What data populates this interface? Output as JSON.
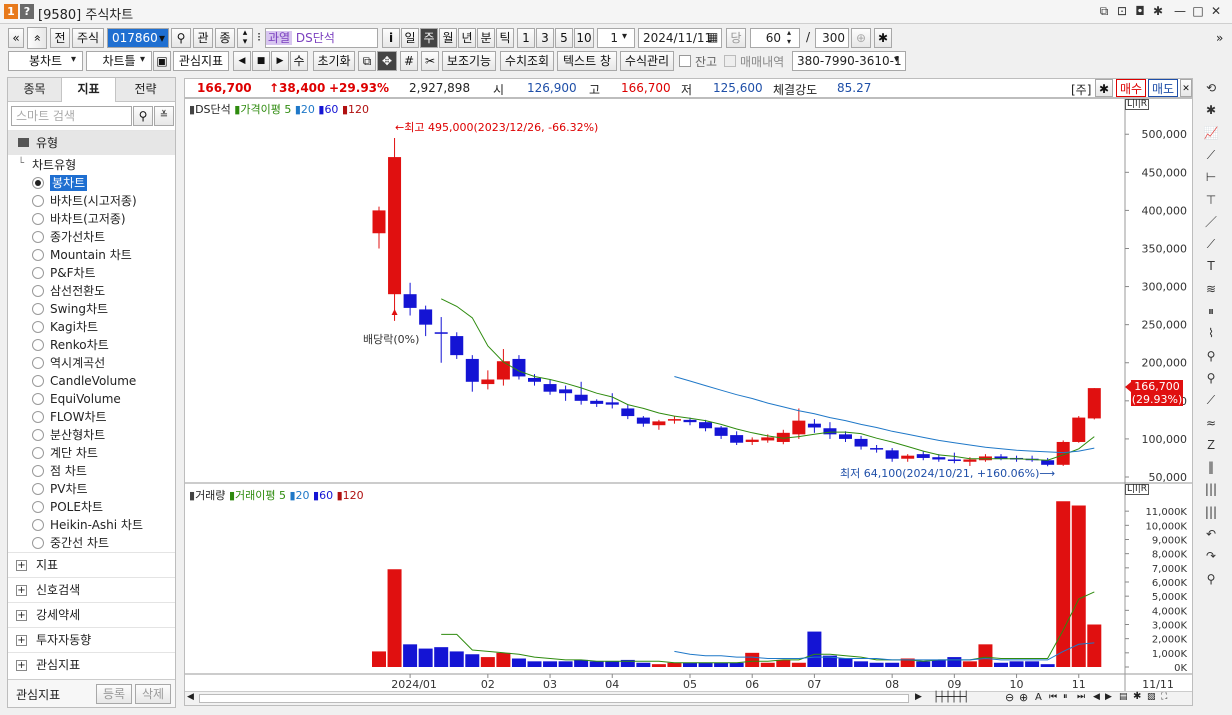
{
  "window": {
    "badge1": "1",
    "badge2": "?",
    "title": "[9580] 주식차트"
  },
  "toolbar1": {
    "items": [
      "«",
      "»",
      "전",
      "주식",
      "017860",
      "관",
      "종"
    ],
    "badge": "과열",
    "stock_name": "DS단석",
    "info": "i",
    "periods": [
      "일",
      "주",
      "월",
      "년",
      "분",
      "틱"
    ],
    "active_period": "주",
    "nums": [
      "1",
      "3",
      "5",
      "10"
    ],
    "sel_one": "1",
    "date": "2024/11/11",
    "dang": "당",
    "count": "60",
    "slash": "/",
    "max": "300"
  },
  "toolbar2": {
    "chart_type": "봉차트",
    "chart_frame": "차트틀",
    "indicator": "관심지표",
    "su": "수",
    "reset": "초기화",
    "aux": "보조기능",
    "num_query": "수치조회",
    "text_window": "텍스트 창",
    "formula": "수식관리",
    "balance": "잔고",
    "trade_history": "매매내역",
    "account": "380-7990-3610-1"
  },
  "price_bar": {
    "price": "166,700",
    "change": "↑38,400",
    "rate": "+29.93%",
    "volume": "2,927,898",
    "open_label": "시",
    "open": "126,900",
    "high_label": "고",
    "high": "166,700",
    "low_label": "저",
    "low": "125,600",
    "strength_label": "체결강도",
    "strength": "85.27",
    "unit": "[주]",
    "buy": "매수",
    "sell": "매도"
  },
  "left_panel": {
    "tabs": [
      "종목",
      "지표",
      "전략"
    ],
    "active_tab": "지표",
    "search_placeholder": "스마트 검색",
    "section": "유형",
    "tree_root": "차트유형",
    "chart_types": [
      "봉차트",
      "바차트(시고저종)",
      "바차트(고저종)",
      "종가선차트",
      "Mountain 차트",
      "P&F차트",
      "삼선전환도",
      "Swing차트",
      "Kagi차트",
      "Renko차트",
      "역시계곡선",
      "CandleVolume",
      "EquiVolume",
      "FLOW차트",
      "분산형차트",
      "계단 차트",
      "점 차트",
      "PV차트",
      "POLE차트",
      "Heikin-Ashi 차트",
      "중간선 차트"
    ],
    "selected_type": "봉차트",
    "groups": [
      "지표",
      "신호검색",
      "강세약세",
      "투자자동향",
      "관심지표"
    ],
    "footer_label": "관심지표",
    "register": "등록",
    "delete": "삭제"
  },
  "price_chart": {
    "legend": {
      "name": "DS단석",
      "ma_label": "가격이평",
      "periods": [
        "5",
        "20",
        "60",
        "120"
      ]
    },
    "y_ticks": [
      "500,000",
      "450,000",
      "400,000",
      "350,000",
      "300,000",
      "250,000",
      "200,000",
      "150,000",
      "100,000",
      "50,000"
    ],
    "high_annotation": "←최고 495,000(2023/12/26, -66.32%)",
    "low_annotation": "최저 64,100(2024/10/21, +160.06%)⟶",
    "dividend": "배당락(0%)",
    "last_price": "166,700",
    "last_rate": "(29.93%)",
    "corner": "L|I|R"
  },
  "volume_chart": {
    "legend": {
      "name": "거래량",
      "ma_label": "거래이평",
      "periods": [
        "5",
        "20",
        "60",
        "120"
      ]
    },
    "y_ticks": [
      "11,000K",
      "10,000K",
      "9,000K",
      "8,000K",
      "7,000K",
      "6,000K",
      "5,000K",
      "4,000K",
      "3,000K",
      "2,000K",
      "1,000K",
      "0K"
    ],
    "corner": "L|I|R"
  },
  "x_axis": [
    "2024/01",
    "02",
    "03",
    "04",
    "05",
    "06",
    "07",
    "08",
    "09",
    "10",
    "11"
  ],
  "x_end": "11/11",
  "colors": {
    "up": "#e01010",
    "down": "#1414d4",
    "ma5": "#2e8b0e",
    "ma20": "#1f78c8",
    "accent": "#1f6fd1"
  },
  "chart_data": {
    "type": "candlestick",
    "title": "DS단석",
    "period": "weekly",
    "candles": [
      {
        "o": 370000,
        "h": 405000,
        "l": 350000,
        "c": 400000
      },
      {
        "o": 290000,
        "h": 495000,
        "l": 255000,
        "c": 470000
      },
      {
        "o": 290000,
        "h": 305000,
        "l": 262000,
        "c": 272000
      },
      {
        "o": 270000,
        "h": 275000,
        "l": 235000,
        "c": 250000
      },
      {
        "o": 240000,
        "h": 260000,
        "l": 200000,
        "c": 238000
      },
      {
        "o": 235000,
        "h": 240000,
        "l": 205000,
        "c": 210000
      },
      {
        "o": 205000,
        "h": 210000,
        "l": 162000,
        "c": 175000
      },
      {
        "o": 172000,
        "h": 190000,
        "l": 165000,
        "c": 178000
      },
      {
        "o": 178000,
        "h": 218000,
        "l": 170000,
        "c": 202000
      },
      {
        "o": 205000,
        "h": 210000,
        "l": 178000,
        "c": 182000
      },
      {
        "o": 180000,
        "h": 185000,
        "l": 170000,
        "c": 175000
      },
      {
        "o": 172000,
        "h": 178000,
        "l": 158000,
        "c": 162000
      },
      {
        "o": 165000,
        "h": 170000,
        "l": 150000,
        "c": 160000
      },
      {
        "o": 158000,
        "h": 175000,
        "l": 145000,
        "c": 150000
      },
      {
        "o": 150000,
        "h": 152000,
        "l": 142000,
        "c": 146000
      },
      {
        "o": 148000,
        "h": 160000,
        "l": 140000,
        "c": 145000
      },
      {
        "o": 140000,
        "h": 145000,
        "l": 126000,
        "c": 130000
      },
      {
        "o": 128000,
        "h": 130000,
        "l": 116000,
        "c": 120000
      },
      {
        "o": 118000,
        "h": 125000,
        "l": 112000,
        "c": 123000
      },
      {
        "o": 124000,
        "h": 130000,
        "l": 120000,
        "c": 126000
      },
      {
        "o": 125000,
        "h": 128000,
        "l": 118000,
        "c": 122000
      },
      {
        "o": 122000,
        "h": 125000,
        "l": 110000,
        "c": 114000
      },
      {
        "o": 115000,
        "h": 117000,
        "l": 100000,
        "c": 104000
      },
      {
        "o": 105000,
        "h": 110000,
        "l": 92000,
        "c": 95000
      },
      {
        "o": 96000,
        "h": 102000,
        "l": 92000,
        "c": 99000
      },
      {
        "o": 98000,
        "h": 106000,
        "l": 95000,
        "c": 102000
      },
      {
        "o": 96000,
        "h": 112000,
        "l": 93000,
        "c": 108000
      },
      {
        "o": 106000,
        "h": 140000,
        "l": 100000,
        "c": 124000
      },
      {
        "o": 120000,
        "h": 126000,
        "l": 108000,
        "c": 115000
      },
      {
        "o": 114000,
        "h": 122000,
        "l": 100000,
        "c": 106000
      },
      {
        "o": 106000,
        "h": 110000,
        "l": 96000,
        "c": 100000
      },
      {
        "o": 100000,
        "h": 104000,
        "l": 86000,
        "c": 90000
      },
      {
        "o": 88000,
        "h": 92000,
        "l": 82000,
        "c": 86000
      },
      {
        "o": 85000,
        "h": 88000,
        "l": 70000,
        "c": 74000
      },
      {
        "o": 74000,
        "h": 80000,
        "l": 70000,
        "c": 78000
      },
      {
        "o": 80000,
        "h": 84000,
        "l": 72000,
        "c": 75000
      },
      {
        "o": 76000,
        "h": 80000,
        "l": 70000,
        "c": 73000
      },
      {
        "o": 73000,
        "h": 82000,
        "l": 68000,
        "c": 72000
      },
      {
        "o": 70000,
        "h": 76000,
        "l": 64500,
        "c": 73000
      },
      {
        "o": 72000,
        "h": 80000,
        "l": 70000,
        "c": 77000
      },
      {
        "o": 77000,
        "h": 80000,
        "l": 72000,
        "c": 74000
      },
      {
        "o": 75000,
        "h": 78000,
        "l": 70000,
        "c": 73000
      },
      {
        "o": 74000,
        "h": 78000,
        "l": 70000,
        "c": 72000
      },
      {
        "o": 72000,
        "h": 75000,
        "l": 64100,
        "c": 66000
      },
      {
        "o": 66000,
        "h": 98000,
        "l": 64500,
        "c": 96000
      },
      {
        "o": 96000,
        "h": 130000,
        "l": 95000,
        "c": 128000
      },
      {
        "o": 126900,
        "h": 166700,
        "l": 125600,
        "c": 166700
      }
    ],
    "volumes": [
      1100,
      6900,
      1600,
      1300,
      1400,
      1100,
      900,
      700,
      1000,
      600,
      400,
      400,
      400,
      500,
      400,
      400,
      500,
      300,
      200,
      300,
      300,
      300,
      300,
      300,
      1000,
      300,
      500,
      300,
      2500,
      800,
      600,
      400,
      300,
      300,
      600,
      400,
      500,
      700,
      400,
      1600,
      300,
      400,
      400,
      200,
      11700,
      11400,
      3000
    ],
    "ma_price_5": [
      null,
      null,
      null,
      null,
      284000,
      274000,
      259000,
      222000,
      201000,
      189000,
      182000,
      178000,
      173000,
      167000,
      160000,
      155000,
      145000,
      140000,
      134000,
      130000,
      127000,
      124000,
      119000,
      113000,
      108000,
      104000,
      101000,
      103000,
      106000,
      109000,
      109000,
      107000,
      101000,
      96000,
      90000,
      84000,
      79000,
      77000,
      74000,
      74000,
      74000,
      74000,
      73000,
      72000,
      79000,
      87000,
      103000
    ],
    "ma_price_20": [
      null,
      null,
      null,
      null,
      null,
      null,
      null,
      null,
      null,
      null,
      null,
      null,
      null,
      null,
      null,
      null,
      null,
      null,
      null,
      182000,
      176000,
      170000,
      164000,
      158000,
      153000,
      147000,
      142000,
      137000,
      133000,
      128000,
      124000,
      119000,
      115000,
      110000,
      106000,
      102000,
      98000,
      95000,
      92000,
      89000,
      87000,
      85000,
      84000,
      83000,
      82000,
      84000,
      88000
    ],
    "ma_volume_5": [
      null,
      null,
      null,
      null,
      2300,
      2300,
      1200,
      1100,
      1000,
      900,
      700,
      600,
      500,
      500,
      400,
      400,
      400,
      400,
      400,
      300,
      300,
      300,
      300,
      300,
      400,
      400,
      500,
      500,
      900,
      900,
      800,
      700,
      500,
      500,
      500,
      400,
      500,
      500,
      500,
      700,
      600,
      600,
      600,
      600,
      2600,
      4800,
      5300
    ],
    "ma_volume_20": [
      null,
      null,
      null,
      null,
      null,
      null,
      null,
      null,
      null,
      null,
      null,
      null,
      null,
      null,
      null,
      null,
      null,
      null,
      null,
      1100,
      900,
      800,
      800,
      700,
      700,
      600,
      600,
      600,
      700,
      700,
      600,
      600,
      600,
      500,
      500,
      500,
      500,
      500,
      500,
      600,
      500,
      500,
      500,
      500,
      1100,
      1600,
      1700
    ],
    "ylim": [
      50000,
      520000
    ],
    "volume_ylim": [
      0,
      12000
    ],
    "volume_unit": "K"
  }
}
